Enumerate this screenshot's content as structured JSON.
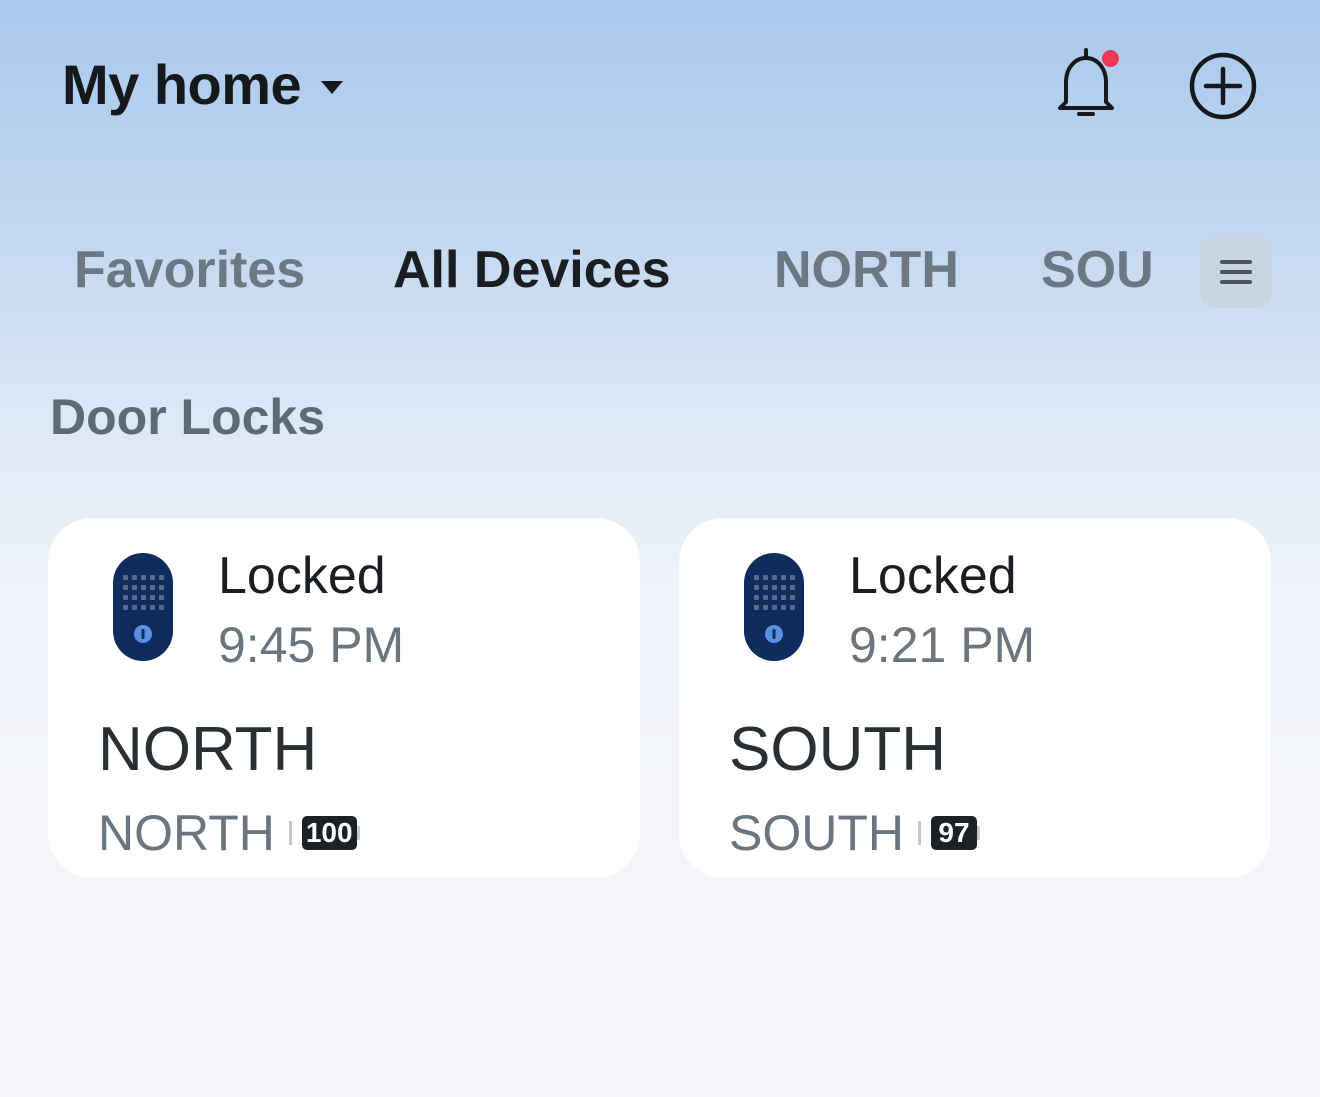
{
  "header": {
    "home_title": "My home"
  },
  "tabs": [
    {
      "label": "Favorites",
      "active": false
    },
    {
      "label": "All Devices",
      "active": true
    },
    {
      "label": "NORTH",
      "active": false
    },
    {
      "label": "SOU",
      "active": false
    }
  ],
  "section": {
    "title": "Door Locks"
  },
  "devices": [
    {
      "status": "Locked",
      "time": "9:45 PM",
      "name": "NORTH",
      "room": "NORTH",
      "battery": "100",
      "icon": "door-lock-icon"
    },
    {
      "status": "Locked",
      "time": "9:21 PM",
      "name": "SOUTH",
      "room": "SOUTH",
      "battery": "97",
      "icon": "door-lock-icon"
    }
  ],
  "colors": {
    "notification_dot": "#f0385a",
    "lock_body": "#0f2c5c",
    "lock_indicator": "#5a8fe6"
  }
}
